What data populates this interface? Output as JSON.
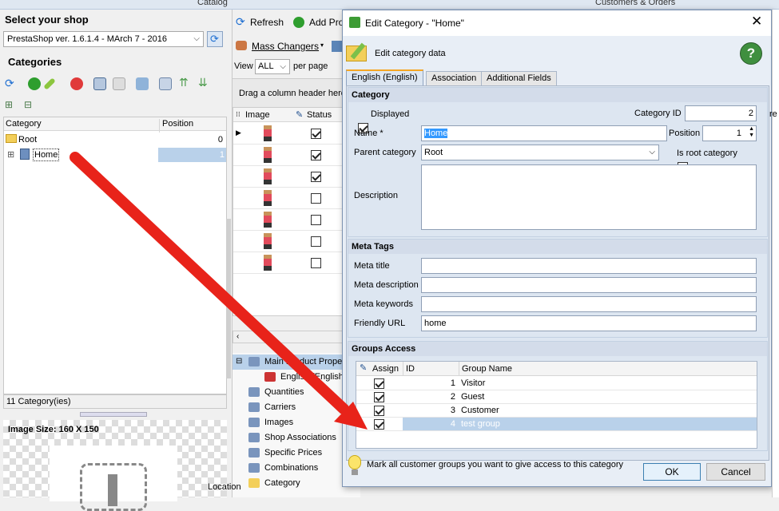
{
  "topbar": {
    "catalog": "Catalog",
    "customers": "Customers & Orders"
  },
  "left": {
    "select_shop_title": "Select your shop",
    "shop_value": "PrestaShop ver. 1.6.1.4 - MArch 7 - 2016",
    "categories_title": "Categories",
    "col_category": "Category",
    "col_position": "Position",
    "tree": [
      {
        "name": "Root",
        "position": "0"
      },
      {
        "name": "Home",
        "position": "1"
      }
    ],
    "count_label": "11 Category(ies)",
    "image_size": "Image Size: 160 X 150"
  },
  "mid": {
    "refresh_label": "Refresh",
    "add_prod_label": "Add Pro",
    "mass_changers_label": "Mass Changers",
    "view_label": "View",
    "view_value": "ALL",
    "per_page_label": "per page",
    "drag_hint": "Drag a column header here",
    "col_image": "Image",
    "col_status": "Status",
    "status_checks": [
      true,
      true,
      true,
      false,
      false,
      false,
      false
    ],
    "panel_items": [
      {
        "label": "Main Product Proper",
        "icon": "product-properties-icon"
      },
      {
        "label": "English (English)",
        "icon": "flag-icon"
      },
      {
        "label": "Quantities",
        "icon": "quantities-icon"
      },
      {
        "label": "Carriers",
        "icon": "carriers-icon"
      },
      {
        "label": "Images",
        "icon": "images-icon"
      },
      {
        "label": "Shop Associations",
        "icon": "globe-icon"
      },
      {
        "label": "Specific Prices",
        "icon": "specific-prices-icon"
      },
      {
        "label": "Combinations",
        "icon": "combinations-icon"
      },
      {
        "label": "Category",
        "icon": "folder-icon"
      }
    ],
    "location_label": "Location"
  },
  "dialog": {
    "title": "Edit Category - \"Home\"",
    "subtitle": "Edit category data",
    "tabs": [
      "English (English)",
      "Association",
      "Additional Fields"
    ],
    "category_group": "Category",
    "displayed_label": "Displayed",
    "displayed_checked": true,
    "category_id_label": "Category ID",
    "category_id_value": "2",
    "name_label": "Name *",
    "name_value": "Home",
    "position_label": "Position",
    "position_value": "1",
    "parent_label": "Parent category",
    "parent_value": "Root",
    "is_root_label": "Is root category",
    "is_root_checked": true,
    "description_label": "Description",
    "description_value": "",
    "meta_group": "Meta Tags",
    "meta_title_label": "Meta title",
    "meta_title_value": "",
    "meta_desc_label": "Meta description",
    "meta_desc_value": "",
    "meta_kw_label": "Meta keywords",
    "meta_kw_value": "",
    "friendly_url_label": "Friendly URL",
    "friendly_url_value": "home",
    "groups_group": "Groups Access",
    "groups_cols": {
      "assign": "Assign",
      "id": "ID",
      "name": "Group Name"
    },
    "groups": [
      {
        "assigned": true,
        "id": "1",
        "name": "Visitor"
      },
      {
        "assigned": true,
        "id": "2",
        "name": "Guest"
      },
      {
        "assigned": true,
        "id": "3",
        "name": "Customer"
      },
      {
        "assigned": true,
        "id": "4",
        "name": "test group"
      }
    ],
    "hint": "Mark all customer groups you want to give access to this category",
    "ok_label": "OK",
    "cancel_label": "Cancel"
  },
  "colors": {
    "accent": "#3399ff",
    "arrow": "#e8231a",
    "selection": "#b9d1ea"
  },
  "right_edge": {
    "partial_text": "re"
  }
}
